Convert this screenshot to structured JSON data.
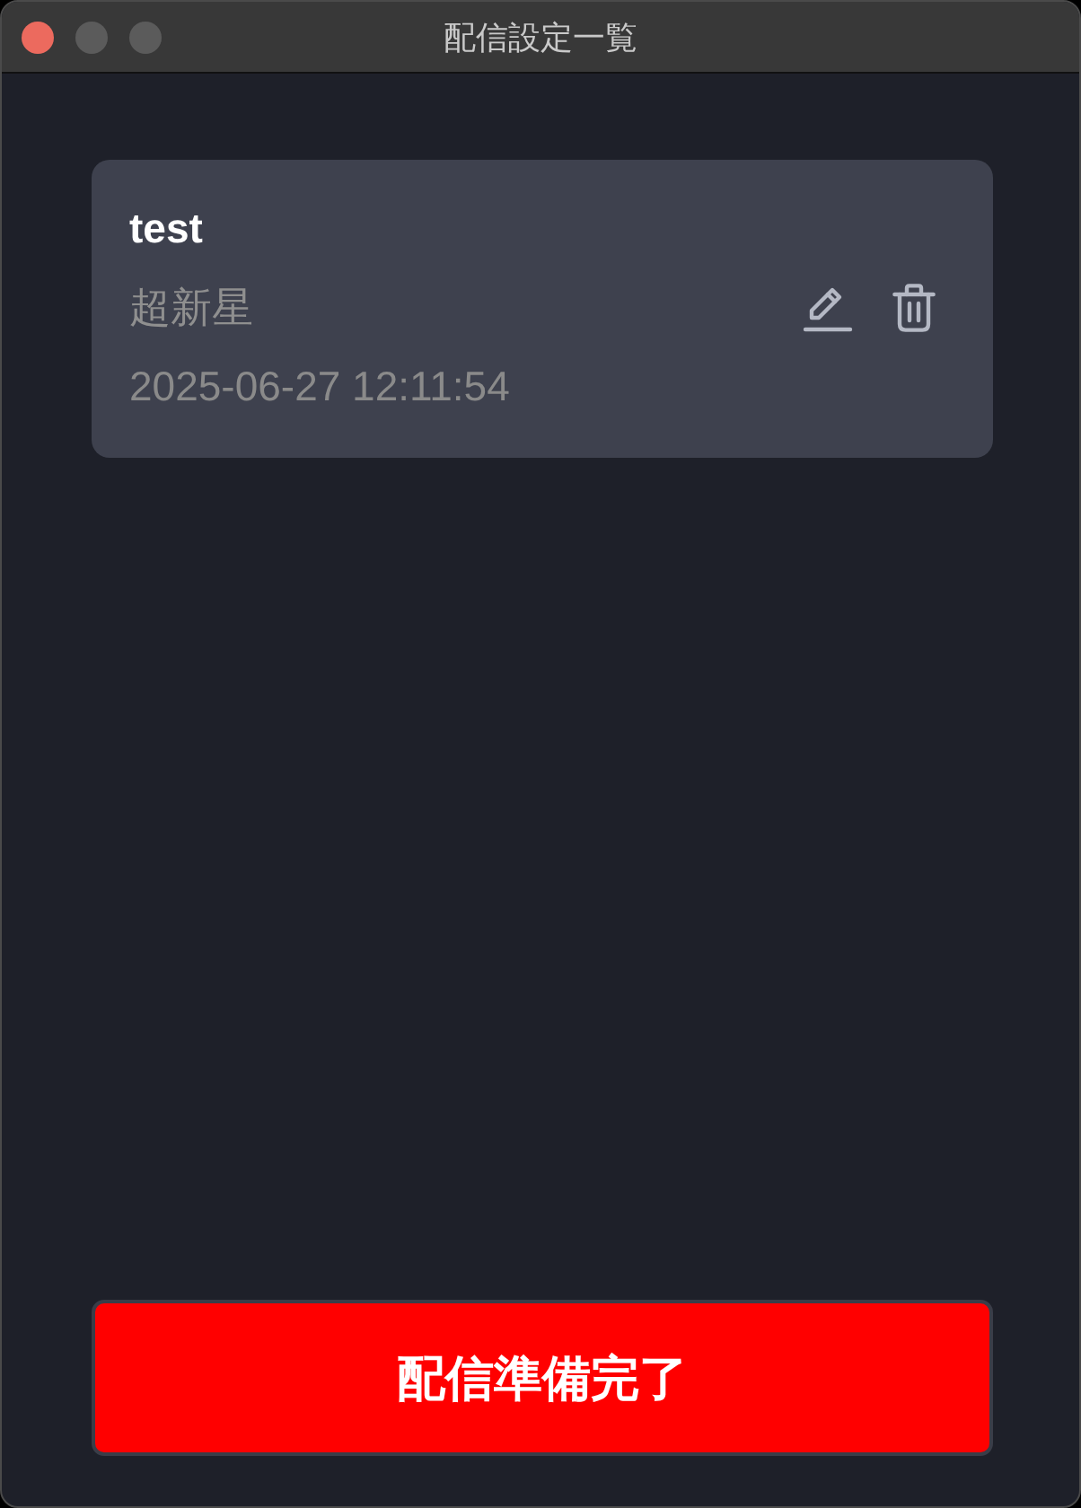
{
  "window": {
    "title": "配信設定一覧",
    "traffic_lights": [
      {
        "kind": "close",
        "disabled": false
      },
      {
        "kind": "minimize",
        "disabled": true
      },
      {
        "kind": "zoom",
        "disabled": true
      }
    ]
  },
  "settings": [
    {
      "name": "test",
      "subtitle": "超新星",
      "timestamp": "2025-06-27 12:11:54"
    }
  ],
  "footer_button": {
    "label": "配信準備完了"
  }
}
